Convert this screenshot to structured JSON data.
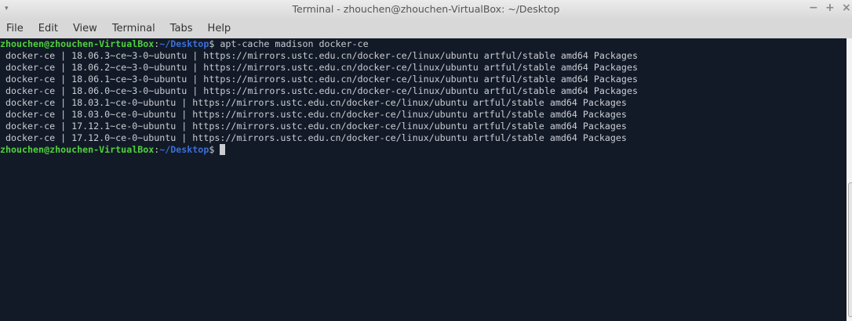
{
  "window": {
    "title": "Terminal - zhouchen@zhouchen-VirtualBox: ~/Desktop",
    "minimize": "−",
    "maximize": "+",
    "close": "×",
    "menu_arrow": "▾"
  },
  "menu": [
    "File",
    "Edit",
    "View",
    "Terminal",
    "Tabs",
    "Help"
  ],
  "prompt": {
    "user_host": "zhouchen@zhouchen-VirtualBox",
    "sep": ":",
    "path": "~/Desktop",
    "symbol": "$"
  },
  "command": " apt-cache madison docker-ce",
  "output": [
    " docker-ce | 18.06.3~ce~3-0~ubuntu | https://mirrors.ustc.edu.cn/docker-ce/linux/ubuntu artful/stable amd64 Packages",
    " docker-ce | 18.06.2~ce~3-0~ubuntu | https://mirrors.ustc.edu.cn/docker-ce/linux/ubuntu artful/stable amd64 Packages",
    " docker-ce | 18.06.1~ce~3-0~ubuntu | https://mirrors.ustc.edu.cn/docker-ce/linux/ubuntu artful/stable amd64 Packages",
    " docker-ce | 18.06.0~ce~3-0~ubuntu | https://mirrors.ustc.edu.cn/docker-ce/linux/ubuntu artful/stable amd64 Packages",
    " docker-ce | 18.03.1~ce-0~ubuntu | https://mirrors.ustc.edu.cn/docker-ce/linux/ubuntu artful/stable amd64 Packages",
    " docker-ce | 18.03.0~ce-0~ubuntu | https://mirrors.ustc.edu.cn/docker-ce/linux/ubuntu artful/stable amd64 Packages",
    " docker-ce | 17.12.1~ce-0~ubuntu | https://mirrors.ustc.edu.cn/docker-ce/linux/ubuntu artful/stable amd64 Packages",
    " docker-ce | 17.12.0~ce-0~ubuntu | https://mirrors.ustc.edu.cn/docker-ce/linux/ubuntu artful/stable amd64 Packages"
  ]
}
